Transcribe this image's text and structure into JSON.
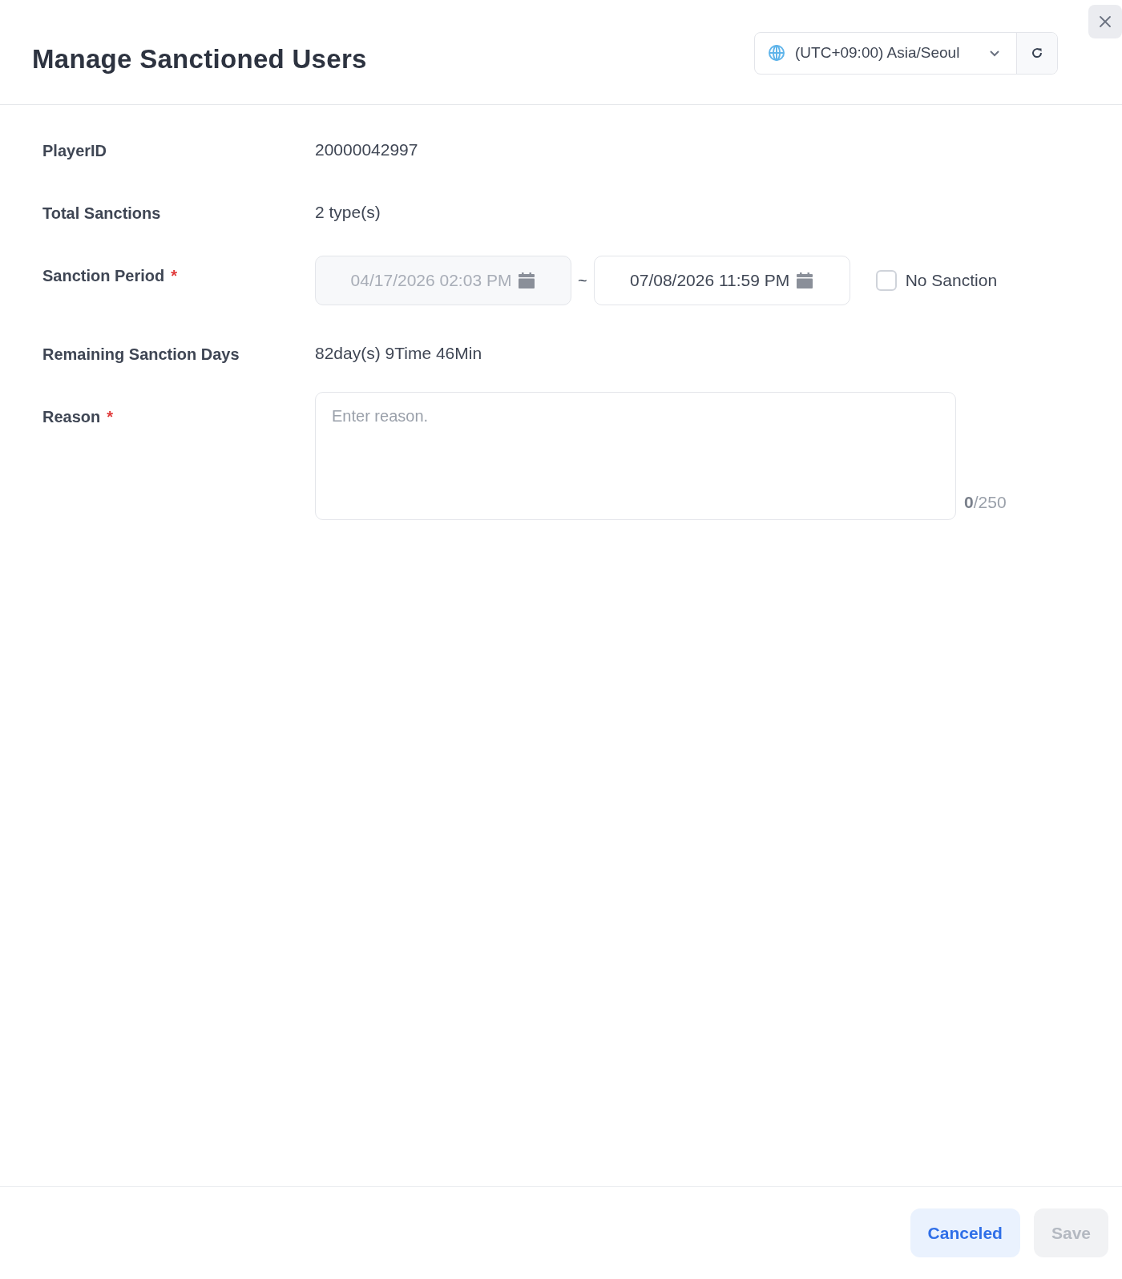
{
  "dialog": {
    "title": "Manage Sanctioned Users"
  },
  "timezone": {
    "value": "(UTC+09:00) Asia/Seoul"
  },
  "fields": [
    {
      "kind": "text",
      "label": "PlayerID",
      "value": "20000042997"
    },
    {
      "kind": "text",
      "label": "Total Sanctions",
      "value": "2 type(s)"
    },
    {
      "kind": "period",
      "label": "Sanction Period",
      "required_mark": "*",
      "start": {
        "value": "04/17/2026 02:03 PM",
        "disabled": true
      },
      "separator": "~",
      "end": {
        "value": "07/08/2026 11:59 PM",
        "disabled": false
      },
      "no_sanction": {
        "label": "No Sanction",
        "checked": false
      }
    },
    {
      "kind": "text",
      "label": "Remaining Sanction Days",
      "value": "82day(s) 9Time 46Min"
    },
    {
      "kind": "textarea",
      "label": "Reason",
      "required_mark": "*",
      "placeholder": "Enter reason.",
      "count": "0",
      "limit": "/250"
    }
  ],
  "buttons": [
    {
      "label": "Canceled",
      "kind": "secondary",
      "disabled": false
    },
    {
      "label": "Save",
      "kind": "primary",
      "disabled": true
    }
  ]
}
